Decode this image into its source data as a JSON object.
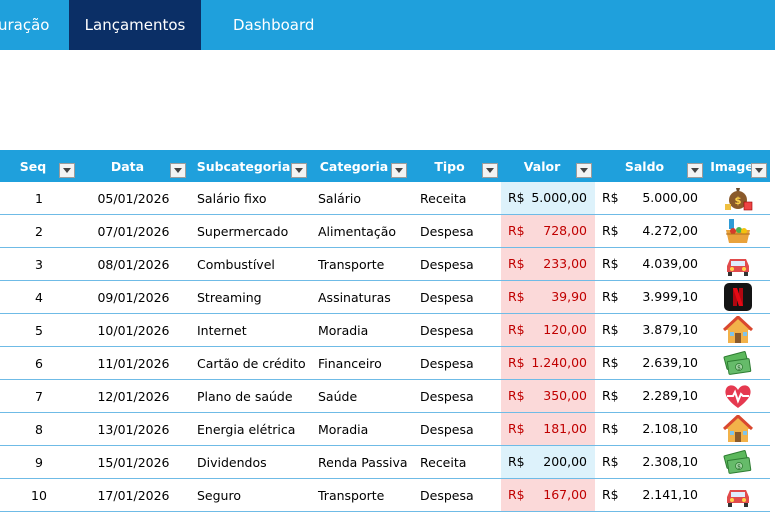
{
  "tabs": [
    {
      "label": "uração",
      "active": false
    },
    {
      "label": "Lançamentos",
      "active": true
    },
    {
      "label": "Dashboard",
      "active": false
    }
  ],
  "table": {
    "headers": [
      "Seq",
      "Data",
      "Subcategoria",
      "Categoria",
      "Tipo",
      "Valor",
      "Saldo",
      "Image"
    ],
    "currency": "R$",
    "rows": [
      {
        "seq": "1",
        "data": "05/01/2026",
        "sub": "Salário fixo",
        "cat": "Salário",
        "tipo": "Receita",
        "valor": "5.000,00",
        "saldo": "5.000,00",
        "icon": "money-bag-icon"
      },
      {
        "seq": "2",
        "data": "07/01/2026",
        "sub": "Supermercado",
        "cat": "Alimentação",
        "tipo": "Despesa",
        "valor": "728,00",
        "saldo": "4.272,00",
        "icon": "groceries-icon"
      },
      {
        "seq": "3",
        "data": "08/01/2026",
        "sub": "Combustível",
        "cat": "Transporte",
        "tipo": "Despesa",
        "valor": "233,00",
        "saldo": "4.039,00",
        "icon": "car-icon"
      },
      {
        "seq": "4",
        "data": "09/01/2026",
        "sub": "Streaming",
        "cat": "Assinaturas",
        "tipo": "Despesa",
        "valor": "39,90",
        "saldo": "3.999,10",
        "icon": "netflix-icon"
      },
      {
        "seq": "5",
        "data": "10/01/2026",
        "sub": "Internet",
        "cat": "Moradia",
        "tipo": "Despesa",
        "valor": "120,00",
        "saldo": "3.879,10",
        "icon": "house-icon"
      },
      {
        "seq": "6",
        "data": "11/01/2026",
        "sub": "Cartão de crédito",
        "cat": "Financeiro",
        "tipo": "Despesa",
        "valor": "1.240,00",
        "saldo": "2.639,10",
        "icon": "cash-icon"
      },
      {
        "seq": "7",
        "data": "12/01/2026",
        "sub": "Plano de saúde",
        "cat": "Saúde",
        "tipo": "Despesa",
        "valor": "350,00",
        "saldo": "2.289,10",
        "icon": "heart-pulse-icon"
      },
      {
        "seq": "8",
        "data": "13/01/2026",
        "sub": "Energia elétrica",
        "cat": "Moradia",
        "tipo": "Despesa",
        "valor": "181,00",
        "saldo": "2.108,10",
        "icon": "house-icon"
      },
      {
        "seq": "9",
        "data": "15/01/2026",
        "sub": "Dividendos",
        "cat": "Renda Passiva",
        "tipo": "Receita",
        "valor": "200,00",
        "saldo": "2.308,10",
        "icon": "cash-icon"
      },
      {
        "seq": "10",
        "data": "17/01/2026",
        "sub": "Seguro",
        "cat": "Transporte",
        "tipo": "Despesa",
        "valor": "167,00",
        "saldo": "2.141,10",
        "icon": "car-icon"
      }
    ]
  },
  "colors": {
    "header_bg": "#1fa0dc",
    "active_tab_bg": "#0b2f66",
    "receita_bg": "#ddf2fb",
    "despesa_bg": "#fbd9d9",
    "despesa_text": "#c00000"
  }
}
